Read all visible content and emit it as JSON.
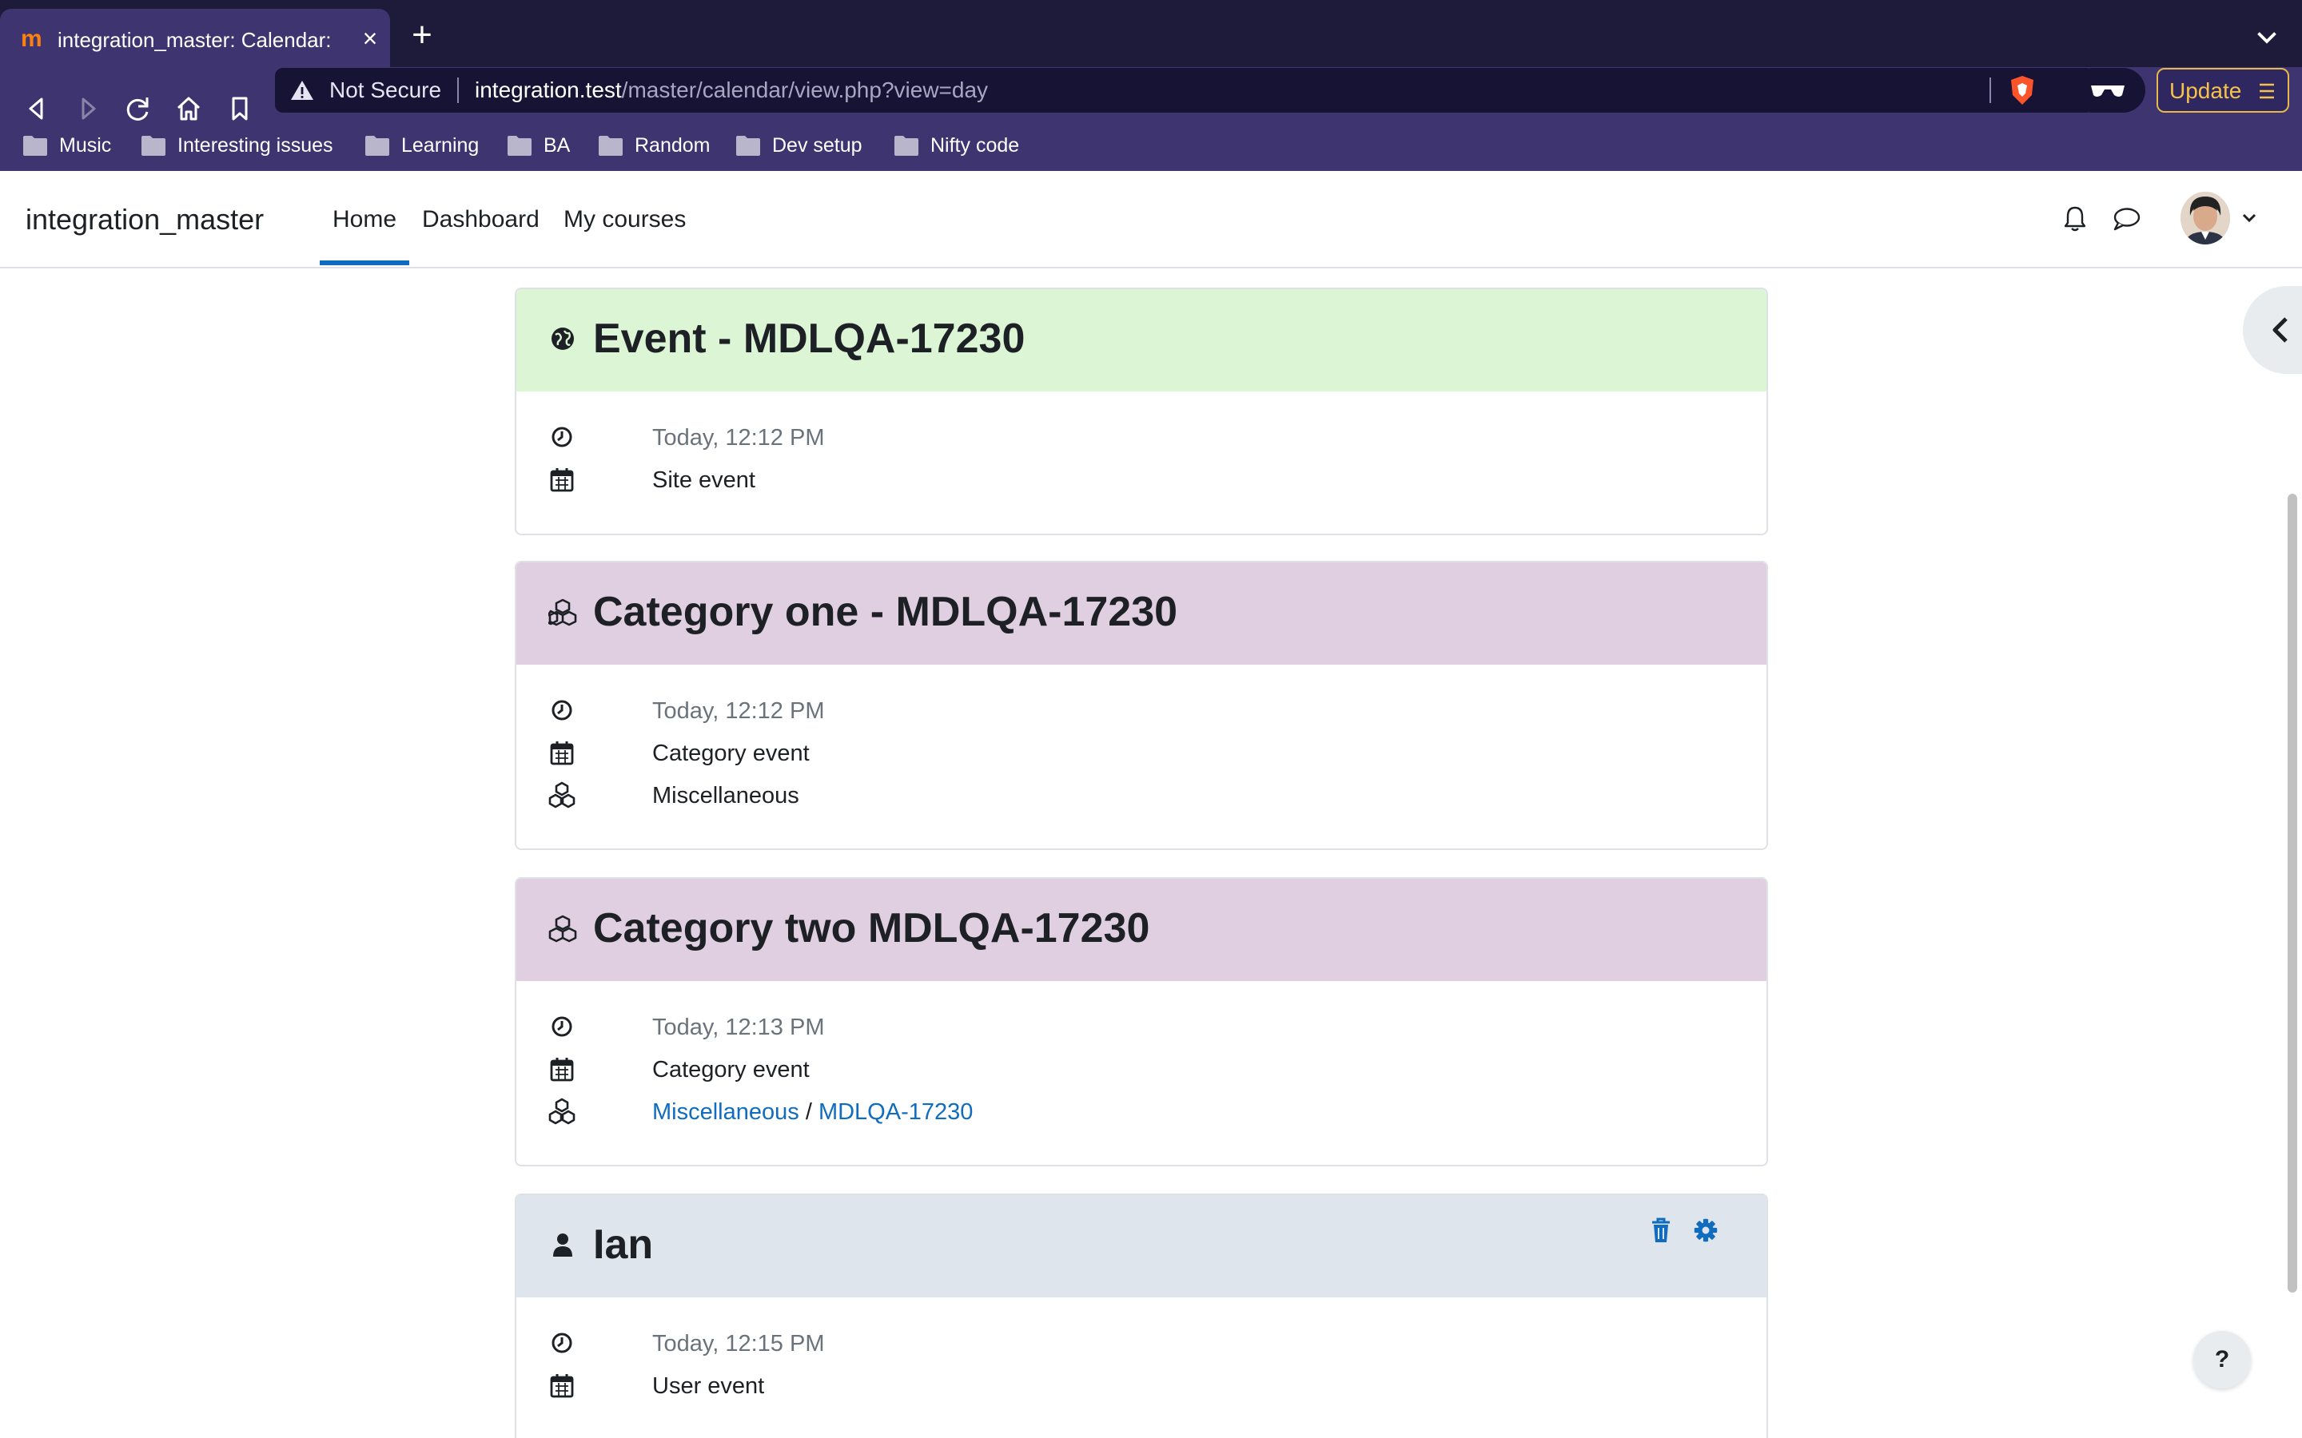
{
  "browser": {
    "tab_title": "integration_master: Calendar: D",
    "address": {
      "security_label": "Not Secure",
      "host": "integration.test",
      "path": "/master/calendar/view.php?view=day"
    },
    "update_label": "Update",
    "bookmarks": [
      {
        "label": "Music"
      },
      {
        "label": "Interesting issues"
      },
      {
        "label": "Learning"
      },
      {
        "label": "BA"
      },
      {
        "label": "Random"
      },
      {
        "label": "Dev setup"
      },
      {
        "label": "Nifty code"
      }
    ]
  },
  "navbar": {
    "site_name": "integration_master",
    "items": [
      {
        "label": "Home",
        "active": true
      },
      {
        "label": "Dashboard"
      },
      {
        "label": "My courses"
      }
    ]
  },
  "events": [
    {
      "title": "Event - MDLQA-17230",
      "type_icon": "globe-icon",
      "header_color": "#dcf5d5",
      "time": "Today, 12:12 PM",
      "event_type": "Site event"
    },
    {
      "title": "Category one - MDLQA-17230",
      "type_icon": "cubes-icon",
      "header_color": "#e0cfe0",
      "time": "Today, 12:12 PM",
      "event_type": "Category event",
      "category_link": "Miscellaneous"
    },
    {
      "title": "Category two MDLQA-17230",
      "type_icon": "cubes-icon",
      "header_color": "#e0cfe0",
      "time": "Today, 12:13 PM",
      "event_type": "Category event",
      "category_link": "Miscellaneous",
      "category_separator": "/",
      "subcategory_link": "MDLQA-17230"
    },
    {
      "title": "Ian",
      "type_icon": "user-icon",
      "header_color": "#dee5ec",
      "time": "Today, 12:15 PM",
      "event_type": "User event"
    }
  ],
  "help_label": "?",
  "colors": {
    "accent": "#0f6cbf",
    "browser_bg": "#3d3470",
    "update": "#f7c24a"
  }
}
